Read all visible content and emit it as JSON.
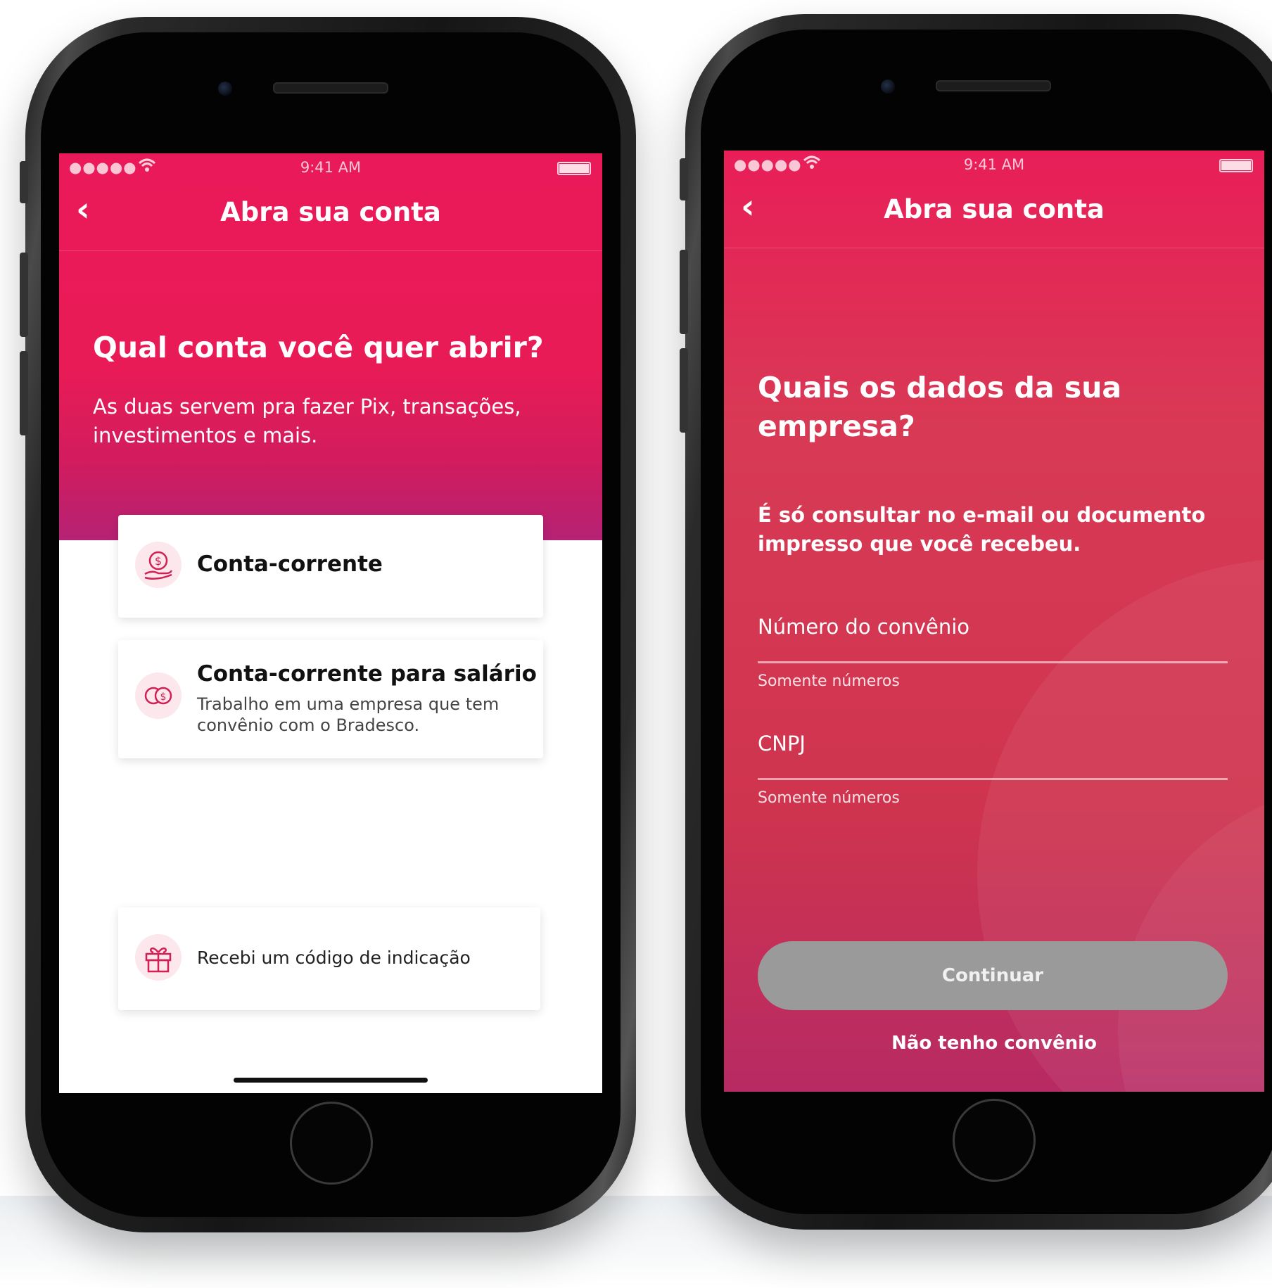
{
  "status_bar": {
    "signal": "●●●●●",
    "time": "9:41 AM"
  },
  "left_screen": {
    "nav_back": "‹",
    "nav_title": "Abra sua conta",
    "heading": "Qual conta você quer abrir?",
    "subtitle_line1": "As duas servem pra fazer Pix, transações,",
    "subtitle_line2": "investimentos e mais.",
    "options": [
      {
        "title": "Conta-corrente",
        "icon": "hand-coin-icon"
      },
      {
        "title": "Conta-corrente para salário",
        "desc_line1": "Trabalho em uma empresa que tem",
        "desc_line2": "convênio com o Bradesco.",
        "icon": "coins-icon"
      }
    ],
    "referral": {
      "label": "Recebi um código de indicação",
      "icon": "gift-icon"
    }
  },
  "right_screen": {
    "nav_back": "‹",
    "nav_title": "Abra sua conta",
    "heading_line1": "Quais os dados da sua",
    "heading_line2": "empresa?",
    "subtitle_line1": "É só consultar no e-mail ou documento",
    "subtitle_line2": "impresso que você recebeu.",
    "fields": [
      {
        "label": "Número do convênio",
        "helper": "Somente números"
      },
      {
        "label": "CNPJ",
        "helper": "Somente números"
      }
    ],
    "continue_button": "Continuar",
    "no_agreement_link": "Não tenho convênio"
  },
  "colors": {
    "brand": "#e8195a",
    "brand_dark": "#b8206a",
    "right_background": "#d2304f",
    "button_disabled": "#9a9a9a"
  }
}
